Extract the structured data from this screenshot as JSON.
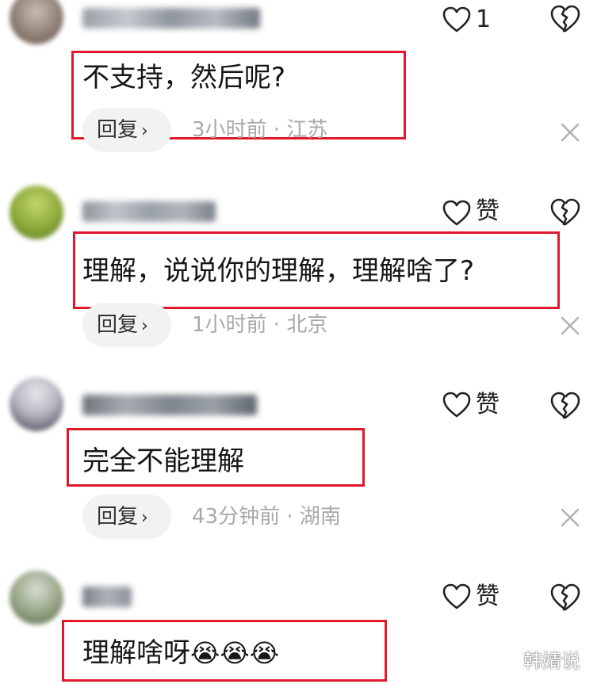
{
  "comments": [
    {
      "username": "███████门",
      "like_label": "1",
      "text": "不支持，然后呢?",
      "reply_label": "回复",
      "meta": "3小时前 · 江苏",
      "avatar_color": "#8a7a70"
    },
    {
      "username": "███████2T",
      "like_label": "赞",
      "text": "理解，说说你的理解，理解啥了?",
      "reply_label": "回复",
      "meta": "1小时前 · 北京",
      "avatar_color": "#7a9a3a"
    },
    {
      "username": "███████",
      "like_label": "赞",
      "text": "完全不能理解",
      "reply_label": "回复",
      "meta": "43分钟前 · 湖南",
      "avatar_color": "#6a6a7a"
    },
    {
      "username": "███",
      "like_label": "赞",
      "text": "理解啥呀",
      "emojis": "😭😭😭",
      "avatar_color": "#7a8a6a"
    }
  ],
  "watermark": "韩婧说",
  "colors": {
    "highlight": "#e0192a",
    "meta_gray": "#a9a9a9",
    "reply_bg": "#f2f2f2"
  },
  "icons": {
    "like": "heart-outline-icon",
    "dislike": "broken-heart-icon",
    "close": "close-icon",
    "chevron": "chevron-right-icon"
  }
}
